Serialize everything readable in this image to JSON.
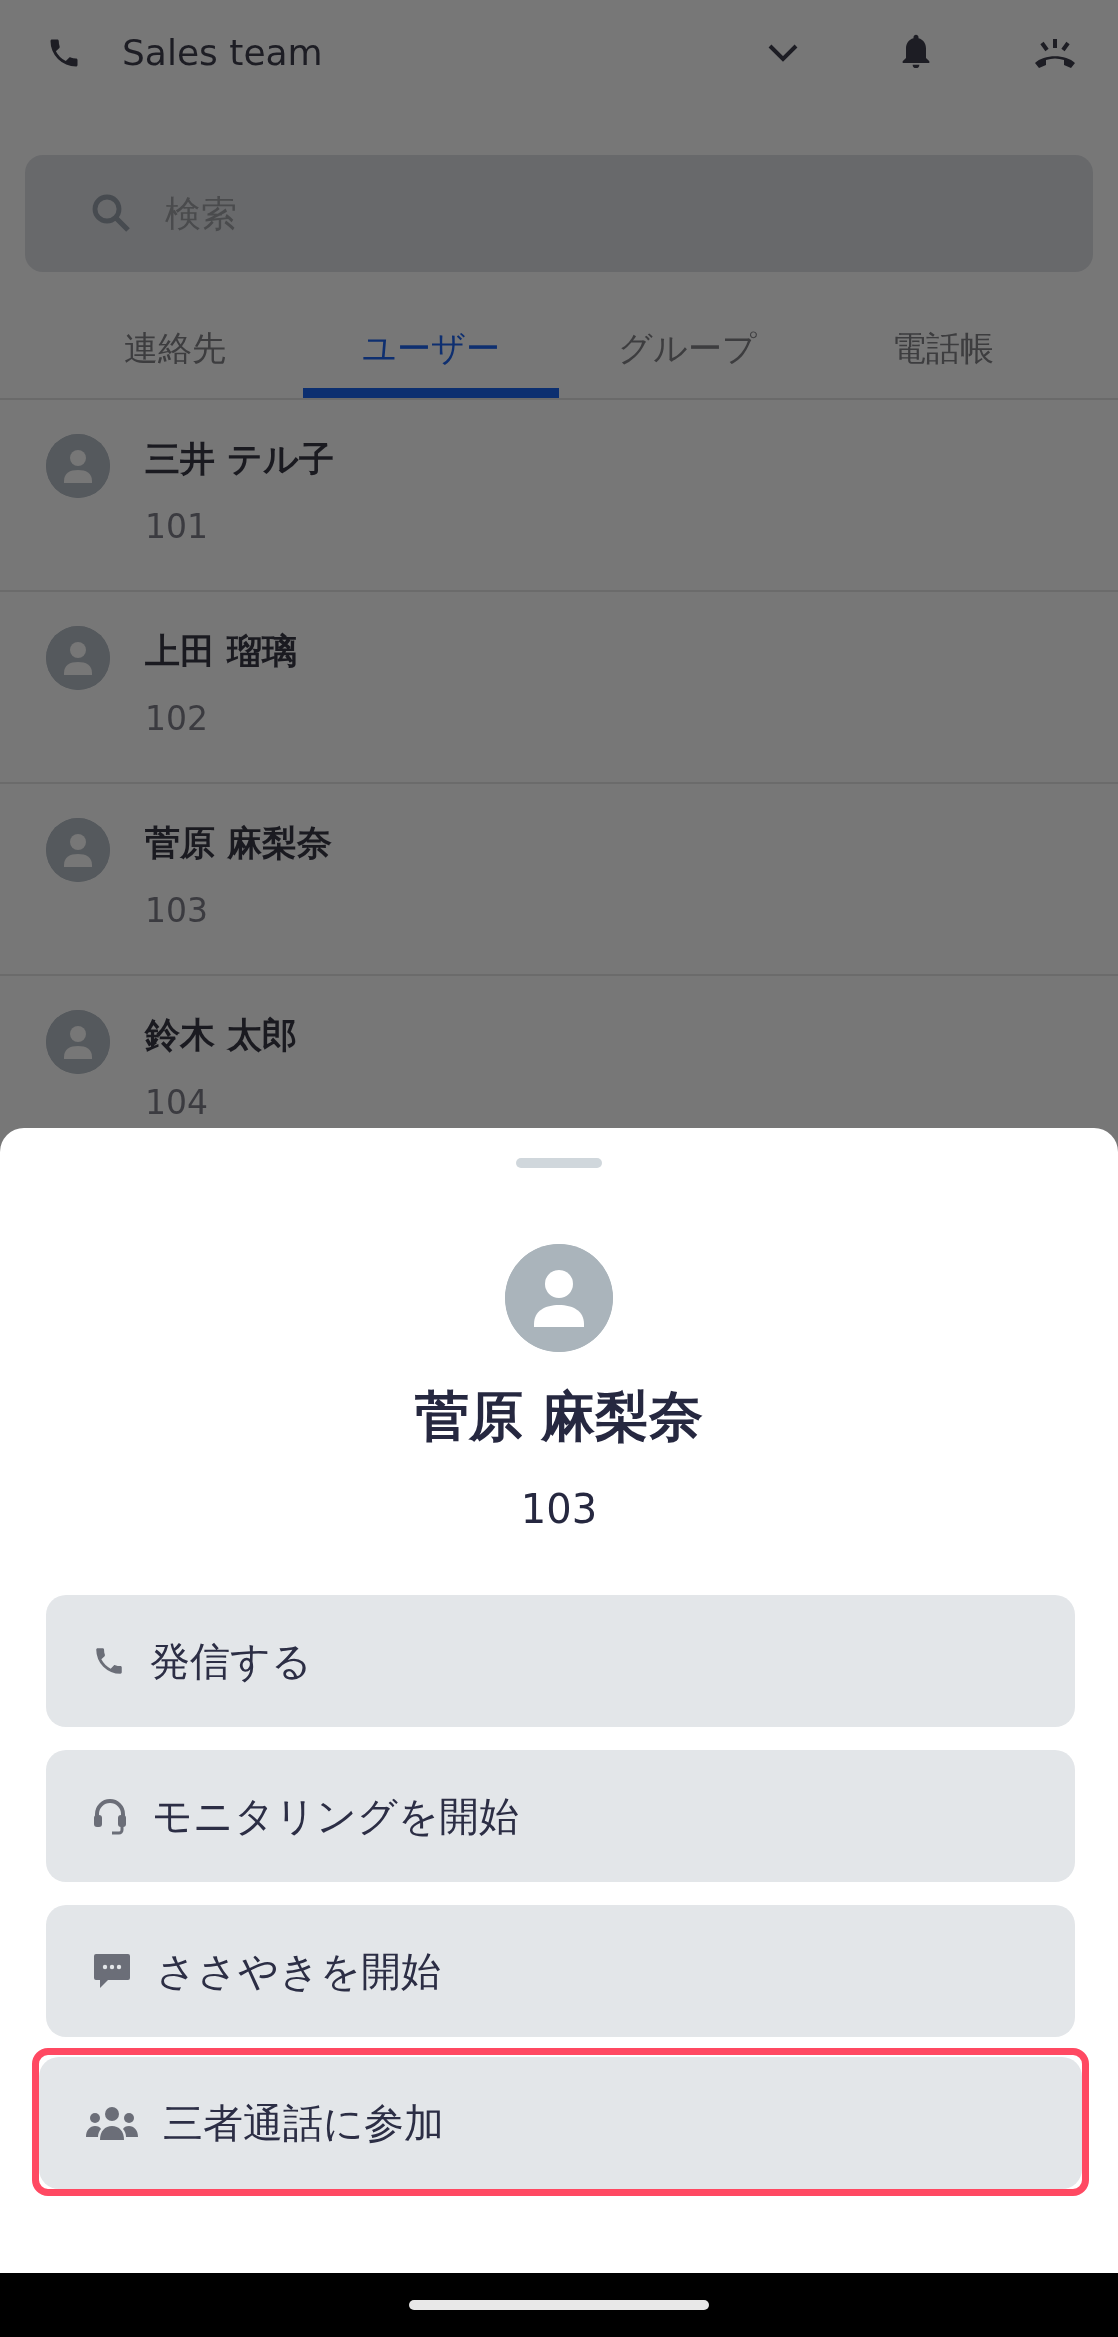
{
  "header": {
    "title": "Sales team"
  },
  "search": {
    "placeholder": "検索"
  },
  "tabs": [
    {
      "label": "連絡先",
      "selected": false
    },
    {
      "label": "ユーザー",
      "selected": true
    },
    {
      "label": "グループ",
      "selected": false
    },
    {
      "label": "電話帳",
      "selected": false
    }
  ],
  "users": [
    {
      "name": "三井 テル子",
      "extension": "101"
    },
    {
      "name": "上田 瑠璃",
      "extension": "102"
    },
    {
      "name": "菅原 麻梨奈",
      "extension": "103"
    },
    {
      "name": "鈴木 太郎",
      "extension": "104"
    }
  ],
  "sheet": {
    "name": "菅原 麻梨奈",
    "extension": "103",
    "actions": [
      {
        "kind": "call",
        "label": "発信する",
        "highlighted": false
      },
      {
        "kind": "monitor",
        "label": "モニタリングを開始",
        "highlighted": false
      },
      {
        "kind": "whisper",
        "label": "ささやきを開始",
        "highlighted": false
      },
      {
        "kind": "conference",
        "label": "三者通話に参加",
        "highlighted": true
      }
    ]
  }
}
